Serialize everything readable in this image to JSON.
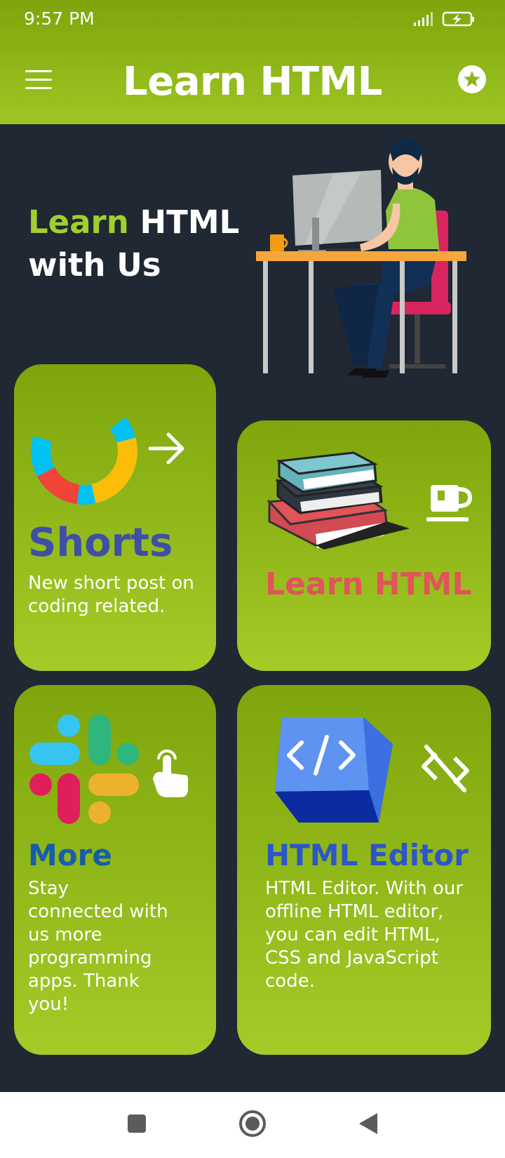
{
  "status_bar": {
    "time": "9:57 PM"
  },
  "app_bar": {
    "title": "Learn HTML"
  },
  "hero": {
    "word1": "Learn",
    "word2": " HTML",
    "line2": "with Us"
  },
  "cards": {
    "shorts": {
      "title": "Shorts",
      "description": "New short post on coding related."
    },
    "learn": {
      "title": "Learn HTML"
    },
    "more": {
      "title": "More",
      "description": "Stay connected with us more programming apps. Thank you!"
    },
    "editor": {
      "title": "HTML Editor",
      "description": "HTML Editor. With our offline HTML editor, you can edit HTML, CSS and JavaScript code."
    }
  },
  "colors": {
    "appbar_green": "#8db51a",
    "background": "#1f2833",
    "shorts_title": "#3f4fa6",
    "learn_title": "#e0545a",
    "more_title": "#165eab",
    "editor_title": "#2c57c9"
  }
}
